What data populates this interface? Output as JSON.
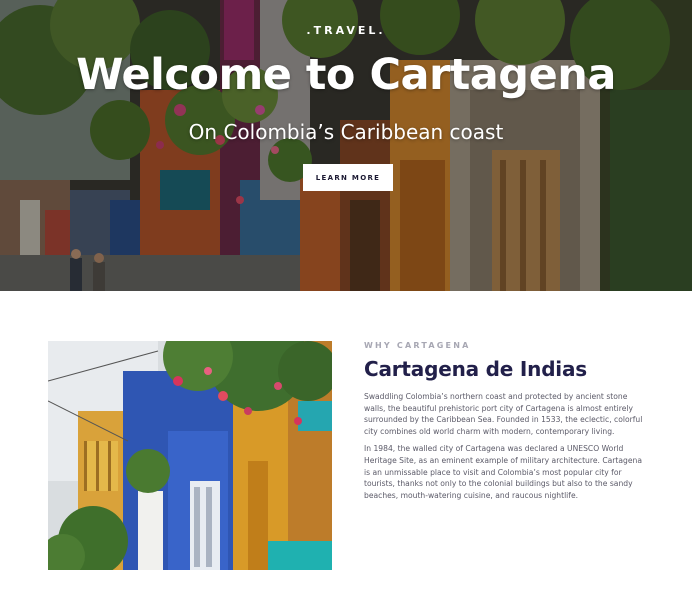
{
  "hero": {
    "brand": ".TRAVEL.",
    "title": "Welcome to Cartagena",
    "subtitle": "On Colombia’s Caribbean coast",
    "cta_label": "LEARN MORE"
  },
  "section": {
    "eyebrow": "WHY CARTAGENA",
    "title": "Cartagena de Indias",
    "paragraphs": [
      "Swaddling Colombia’s northern coast and protected by ancient stone walls, the beautiful prehistoric port city of Cartagena is almost entirely surrounded by the Caribbean Sea. Founded in 1533, the eclectic, colorful city combines old world charm with modern, contemporary living.",
      "In 1984, the walled city of Cartagena was declared a UNESCO World Heritage Site, as an eminent example of military architecture. Cartagena is an unmissable place to visit and Colombia’s most popular city for tourists, thanks not only to the colonial buildings but also to the sandy beaches, mouth-watering cuisine, and raucous nightlife."
    ]
  },
  "colors": {
    "title_navy": "#22204a",
    "eyebrow_gray": "#a7a7b3",
    "body_text": "#5b5a68",
    "button_bg": "#ffffff"
  }
}
